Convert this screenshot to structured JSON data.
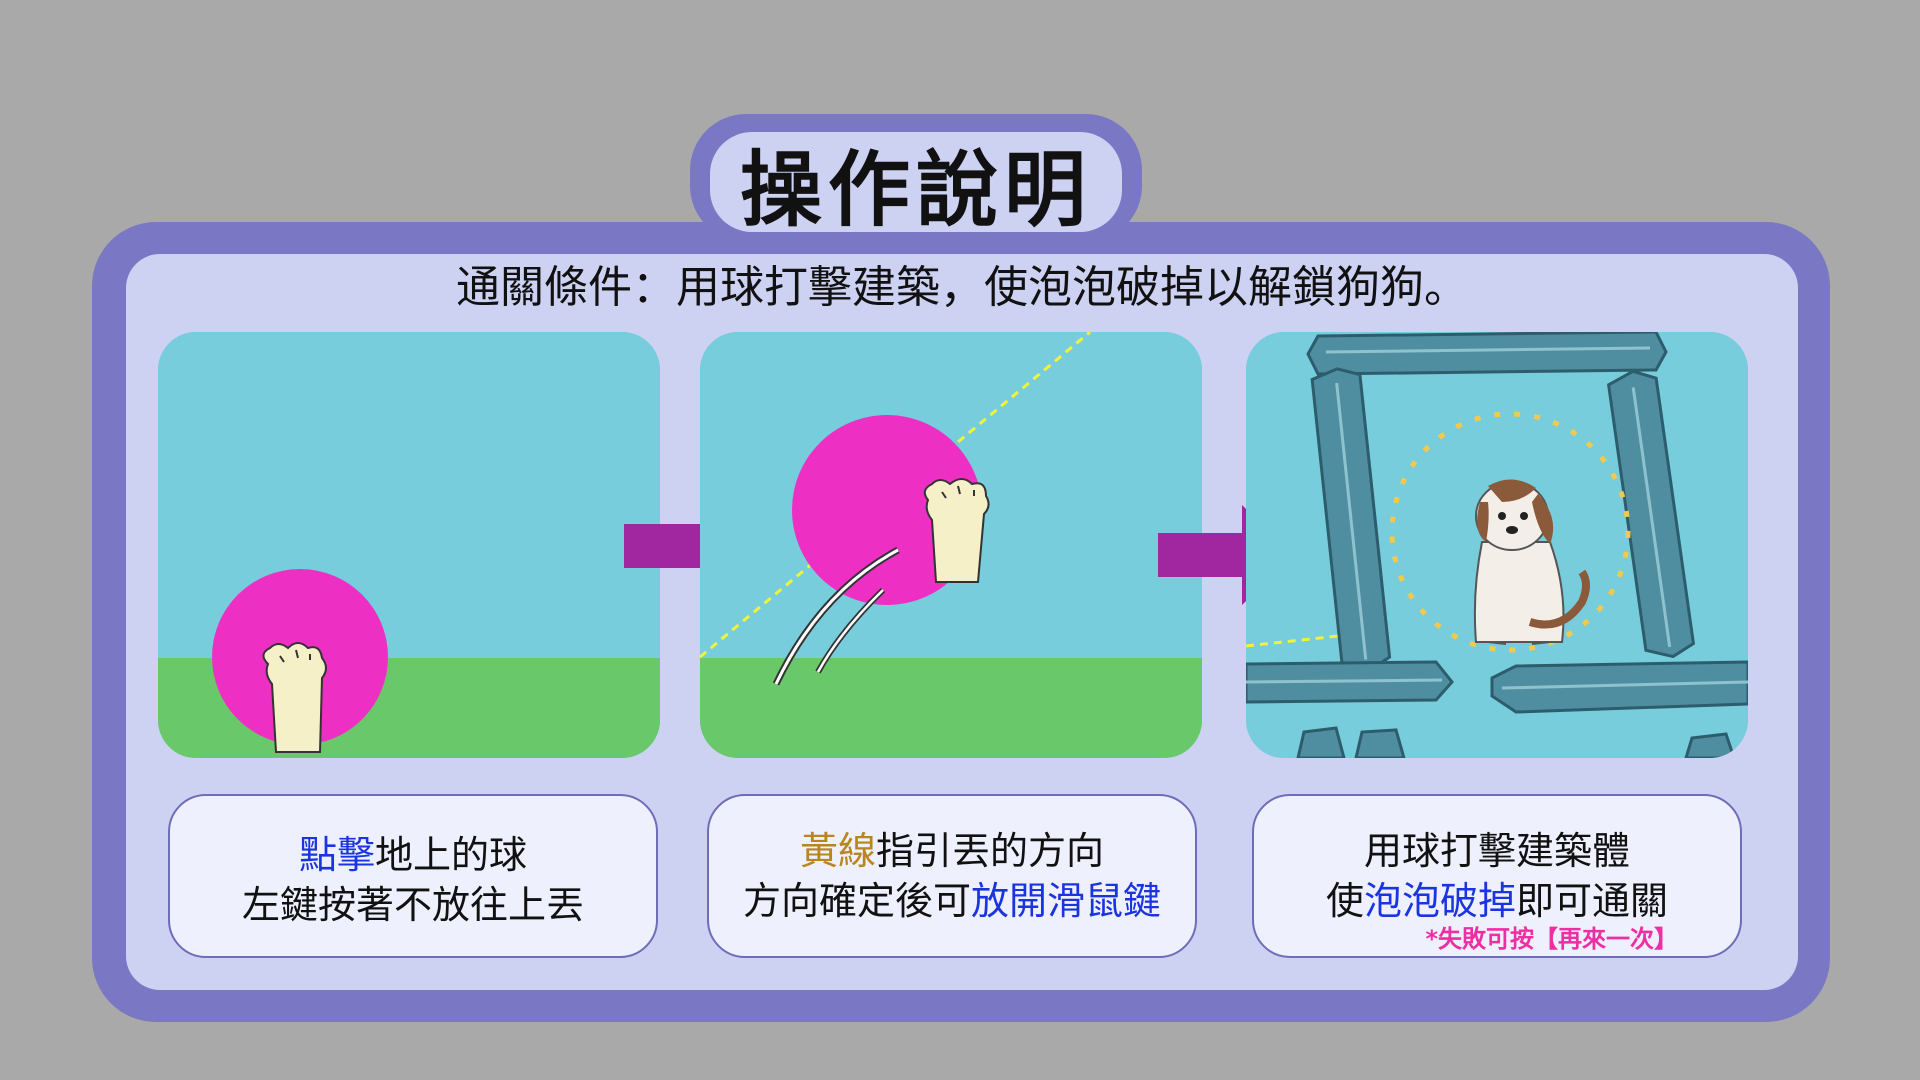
{
  "title": "操作說明",
  "objective": "通關條件：用球打擊建築，使泡泡破掉以解鎖狗狗。",
  "steps": [
    {
      "line1": {
        "highlight": "點擊",
        "rest": "地上的球"
      },
      "line2": "左鍵按著不放往上丟"
    },
    {
      "line1": {
        "highlight": "黃線",
        "rest": "指引丟的方向"
      },
      "line2": {
        "prefix": "方向確定後可",
        "highlight": "放開滑鼠鍵"
      }
    },
    {
      "line1": "用球打擊建築體",
      "line2": {
        "prefix": "使",
        "highlight": "泡泡破掉",
        "suffix": "即可通關"
      },
      "note": "*失敗可按【再來一次】"
    }
  ],
  "colors": {
    "background": "#a9a9a9",
    "frame": "#7a77c4",
    "inner": "#cdd2f3",
    "sky": "#77cddc",
    "grass": "#69c96a",
    "ball": "#ee2fc4",
    "arrow": "#a0279f",
    "guide_line": "#f2f23a",
    "highlight_blue": "#1a35e0",
    "highlight_gold": "#b8861d",
    "note_pink": "#ee2fa4"
  },
  "icons": [
    "paw-hand-icon",
    "arrow-right-icon",
    "crystal-pillar-icon",
    "dog-icon"
  ]
}
